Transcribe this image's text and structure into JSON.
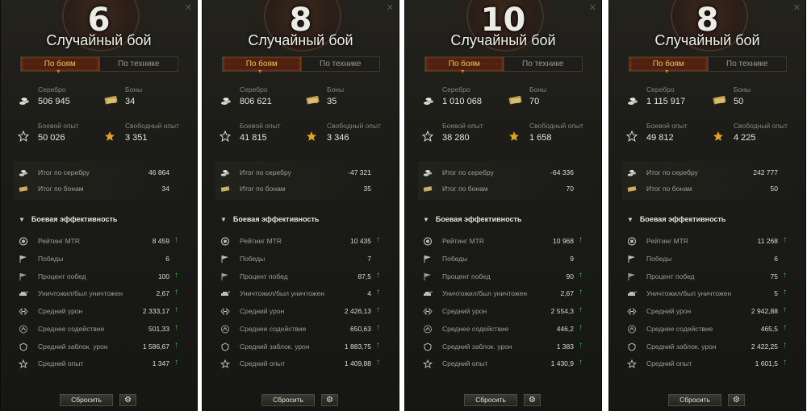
{
  "panels": [
    {
      "tier": "6",
      "mode": "Случайный бой",
      "tabs": [
        "По боям",
        "По технике"
      ],
      "stats": {
        "silver_label": "Серебро",
        "silver": "506 945",
        "bonds_label": "Боны",
        "bonds": "34",
        "xp_label": "Боевой опыт",
        "xp": "50 026",
        "free_xp_label": "Свободный опыт",
        "free_xp": "3 351"
      },
      "totals": [
        {
          "label": "Итог по серебру",
          "value": "46 864"
        },
        {
          "label": "Итог по бонам",
          "value": "34"
        }
      ],
      "section": "Боевая эффективность",
      "metrics": [
        {
          "label": "Рейтинг MTR",
          "value": "8 459",
          "up": true
        },
        {
          "label": "Победы",
          "value": "6",
          "up": false
        },
        {
          "label": "Процент побед",
          "value": "100",
          "up": true
        },
        {
          "label": "Уничтожил/был уничтожен",
          "value": "2,67",
          "up": true
        },
        {
          "label": "Средний урон",
          "value": "2 333,17",
          "up": true
        },
        {
          "label": "Среднее содействие",
          "value": "501,33",
          "up": true
        },
        {
          "label": "Средний заблок. урон",
          "value": "1 586,67",
          "up": true
        },
        {
          "label": "Средний опыт",
          "value": "1 347",
          "up": true
        }
      ],
      "reset": "Сбросить"
    },
    {
      "tier": "8",
      "mode": "Случайный бой",
      "tabs": [
        "По боям",
        "По технике"
      ],
      "stats": {
        "silver_label": "Серебро",
        "silver": "806 621",
        "bonds_label": "Боны",
        "bonds": "35",
        "xp_label": "Боевой опыт",
        "xp": "41 815",
        "free_xp_label": "Свободный опыт",
        "free_xp": "3 346"
      },
      "totals": [
        {
          "label": "Итог по серебру",
          "value": "-47 321"
        },
        {
          "label": "Итог по бонам",
          "value": "35"
        }
      ],
      "section": "Боевая эффективность",
      "metrics": [
        {
          "label": "Рейтинг MTR",
          "value": "10 435",
          "up": true
        },
        {
          "label": "Победы",
          "value": "7",
          "up": false
        },
        {
          "label": "Процент побед",
          "value": "87,5",
          "up": true
        },
        {
          "label": "Уничтожил/был уничтожен",
          "value": "4",
          "up": true
        },
        {
          "label": "Средний урон",
          "value": "2 426,13",
          "up": true
        },
        {
          "label": "Среднее содействие",
          "value": "650,63",
          "up": true
        },
        {
          "label": "Средний заблок. урон",
          "value": "1 883,75",
          "up": true
        },
        {
          "label": "Средний опыт",
          "value": "1 409,88",
          "up": true
        }
      ],
      "reset": "Сбросить"
    },
    {
      "tier": "10",
      "mode": "Случайный бой",
      "tabs": [
        "По боям",
        "По технике"
      ],
      "stats": {
        "silver_label": "Серебро",
        "silver": "1 010 068",
        "bonds_label": "Боны",
        "bonds": "70",
        "xp_label": "Боевой опыт",
        "xp": "38 280",
        "free_xp_label": "Свободный опыт",
        "free_xp": "1 658"
      },
      "totals": [
        {
          "label": "Итог по серебру",
          "value": "-64 336"
        },
        {
          "label": "Итог по бонам",
          "value": "70"
        }
      ],
      "section": "Боевая эффективность",
      "metrics": [
        {
          "label": "Рейтинг MTR",
          "value": "10 968",
          "up": true
        },
        {
          "label": "Победы",
          "value": "9",
          "up": false
        },
        {
          "label": "Процент побед",
          "value": "90",
          "up": true
        },
        {
          "label": "Уничтожил/был уничтожен",
          "value": "2,67",
          "up": true
        },
        {
          "label": "Средний урон",
          "value": "2 554,3",
          "up": true
        },
        {
          "label": "Среднее содействие",
          "value": "446,2",
          "up": true
        },
        {
          "label": "Средний заблок. урон",
          "value": "1 383",
          "up": true
        },
        {
          "label": "Средний опыт",
          "value": "1 430,9",
          "up": true
        }
      ],
      "reset": "Сбросить"
    },
    {
      "tier": "8",
      "mode": "Случайный бой",
      "tabs": [
        "По боям",
        "По технике"
      ],
      "stats": {
        "silver_label": "Серебро",
        "silver": "1 115 917",
        "bonds_label": "Боны",
        "bonds": "50",
        "xp_label": "Боевой опыт",
        "xp": "49 812",
        "free_xp_label": "Свободный опыт",
        "free_xp": "4 225"
      },
      "totals": [
        {
          "label": "Итог по серебру",
          "value": "242 777"
        },
        {
          "label": "Итог по бонам",
          "value": "50"
        }
      ],
      "section": "Боевая эффективность",
      "metrics": [
        {
          "label": "Рейтинг MTR",
          "value": "11 268",
          "up": true
        },
        {
          "label": "Победы",
          "value": "6",
          "up": false
        },
        {
          "label": "Процент побед",
          "value": "75",
          "up": true
        },
        {
          "label": "Уничтожил/был уничтожен",
          "value": "5",
          "up": true
        },
        {
          "label": "Средний урон",
          "value": "2 942,88",
          "up": true
        },
        {
          "label": "Среднее содействие",
          "value": "465,5",
          "up": true
        },
        {
          "label": "Средний заблок. урон",
          "value": "2 422,25",
          "up": true
        },
        {
          "label": "Средний опыт",
          "value": "1 601,5",
          "up": true
        }
      ],
      "reset": "Сбросить"
    }
  ],
  "metric_icons": [
    "mtr-rating-icon",
    "victory-flag-icon",
    "win-percent-icon",
    "kills-ratio-icon",
    "damage-icon",
    "assist-icon",
    "blocked-damage-icon",
    "experience-icon"
  ],
  "colors": {
    "up_arrow": "#37d33c",
    "active_tab": "#5a2410",
    "gold_star": "#e8a020"
  }
}
